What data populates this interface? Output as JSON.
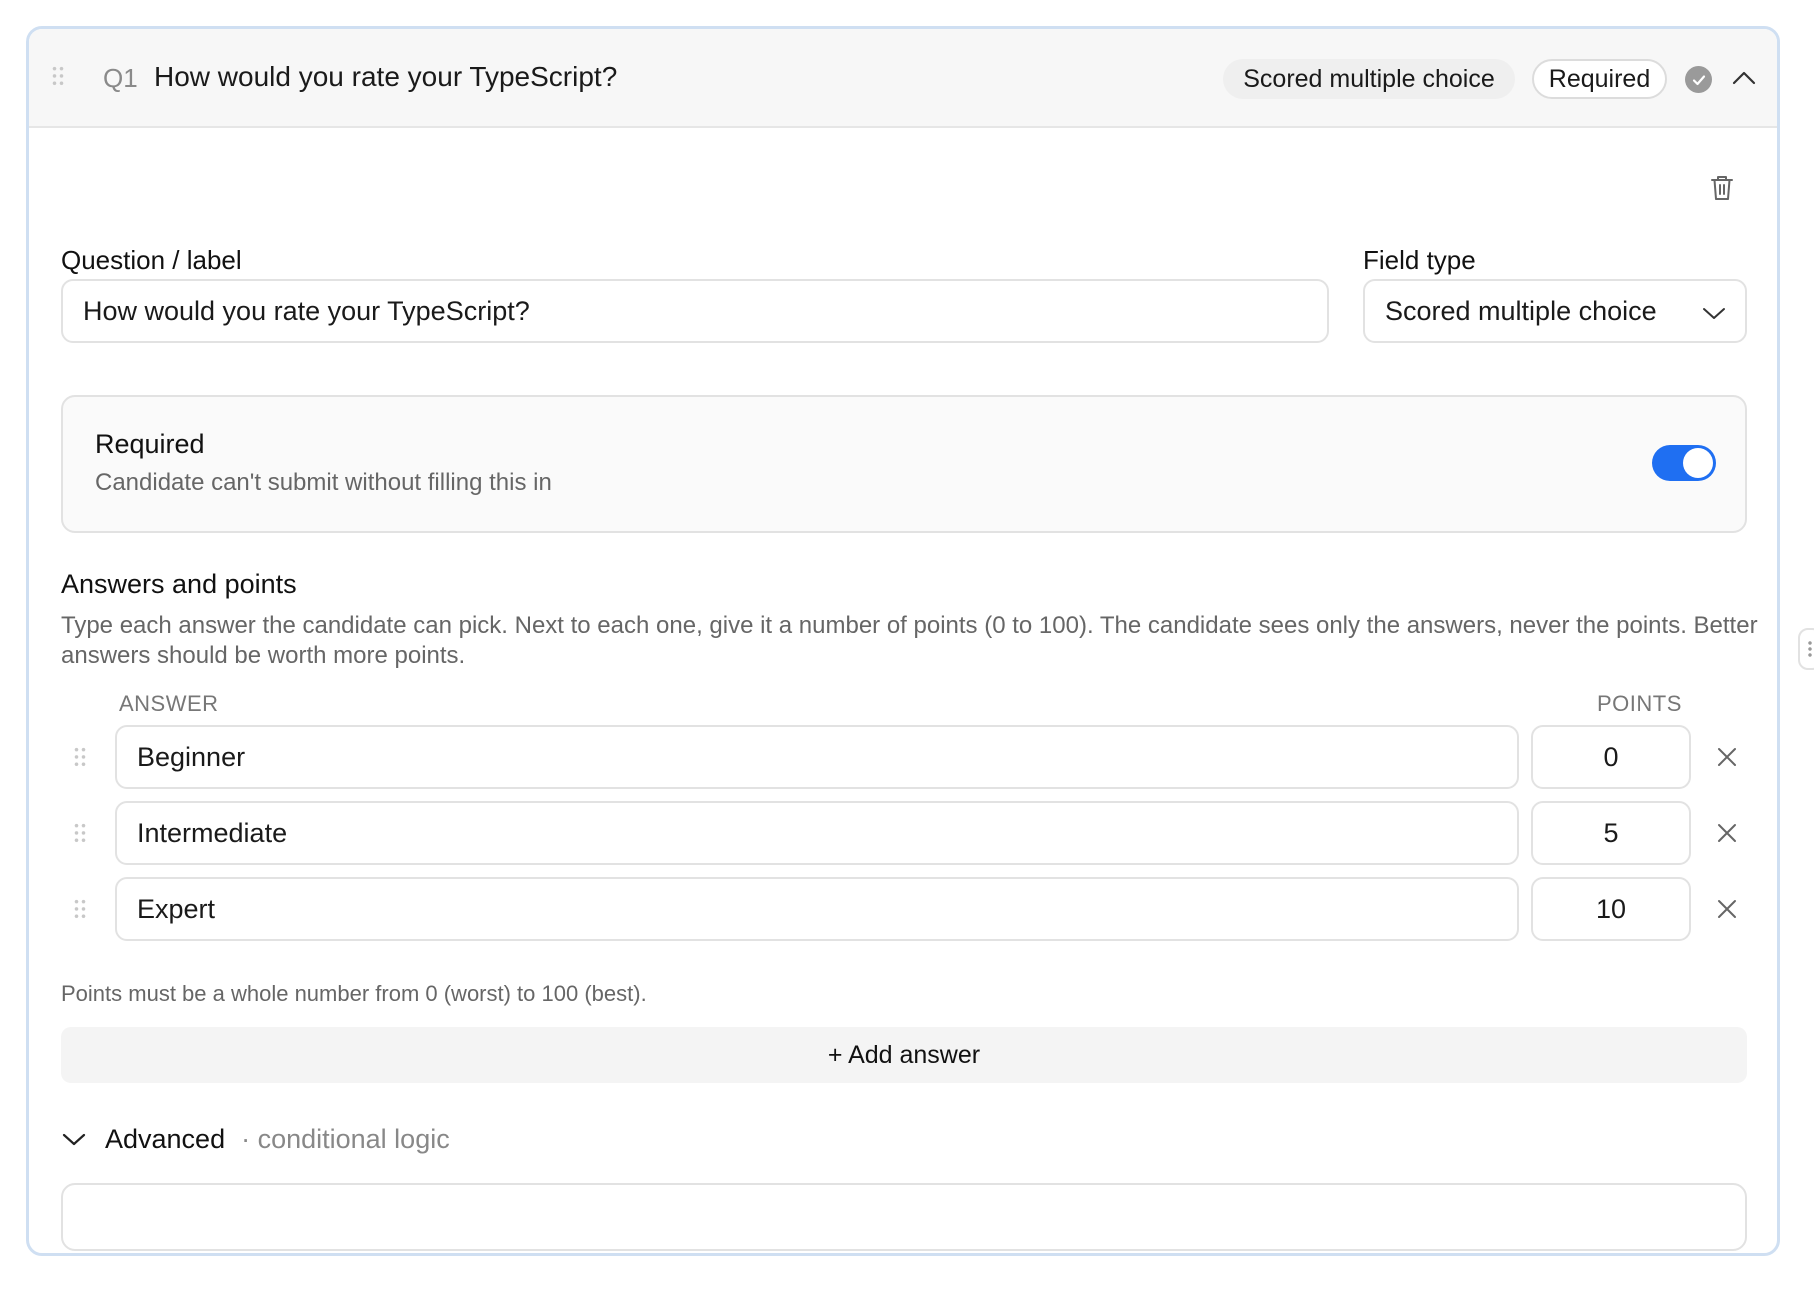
{
  "header": {
    "question_number": "Q1",
    "question_title": "How would you rate your TypeScript?",
    "type_badge": "Scored multiple choice",
    "required_badge": "Required",
    "status_icon": "check-icon",
    "collapse_icon": "chevron-up-icon"
  },
  "form": {
    "question_label": "Question / label",
    "question_value": "How would you rate your TypeScript?",
    "field_type_label": "Field type",
    "field_type_value": "Scored multiple choice"
  },
  "required_setting": {
    "title": "Required",
    "description": "Candidate can't submit without filling this in",
    "enabled": true,
    "accent_color": "#1f6ff2"
  },
  "answers_section": {
    "title": "Answers and points",
    "description": "Type each answer the candidate can pick. Next to each one, give it a number of points (0 to 100). The candidate sees only the answers, never the points. Better answers should be worth more points.",
    "answer_column": "ANSWER",
    "points_column": "POINTS",
    "answers": [
      {
        "answer": "Beginner",
        "points": "0"
      },
      {
        "answer": "Intermediate",
        "points": "5"
      },
      {
        "answer": "Expert",
        "points": "10"
      }
    ],
    "points_note": "Points must be a whole number from 0 (worst) to 100 (best).",
    "add_answer_label": "+ Add answer"
  },
  "advanced": {
    "title": "Advanced",
    "subtitle": "· conditional logic"
  }
}
